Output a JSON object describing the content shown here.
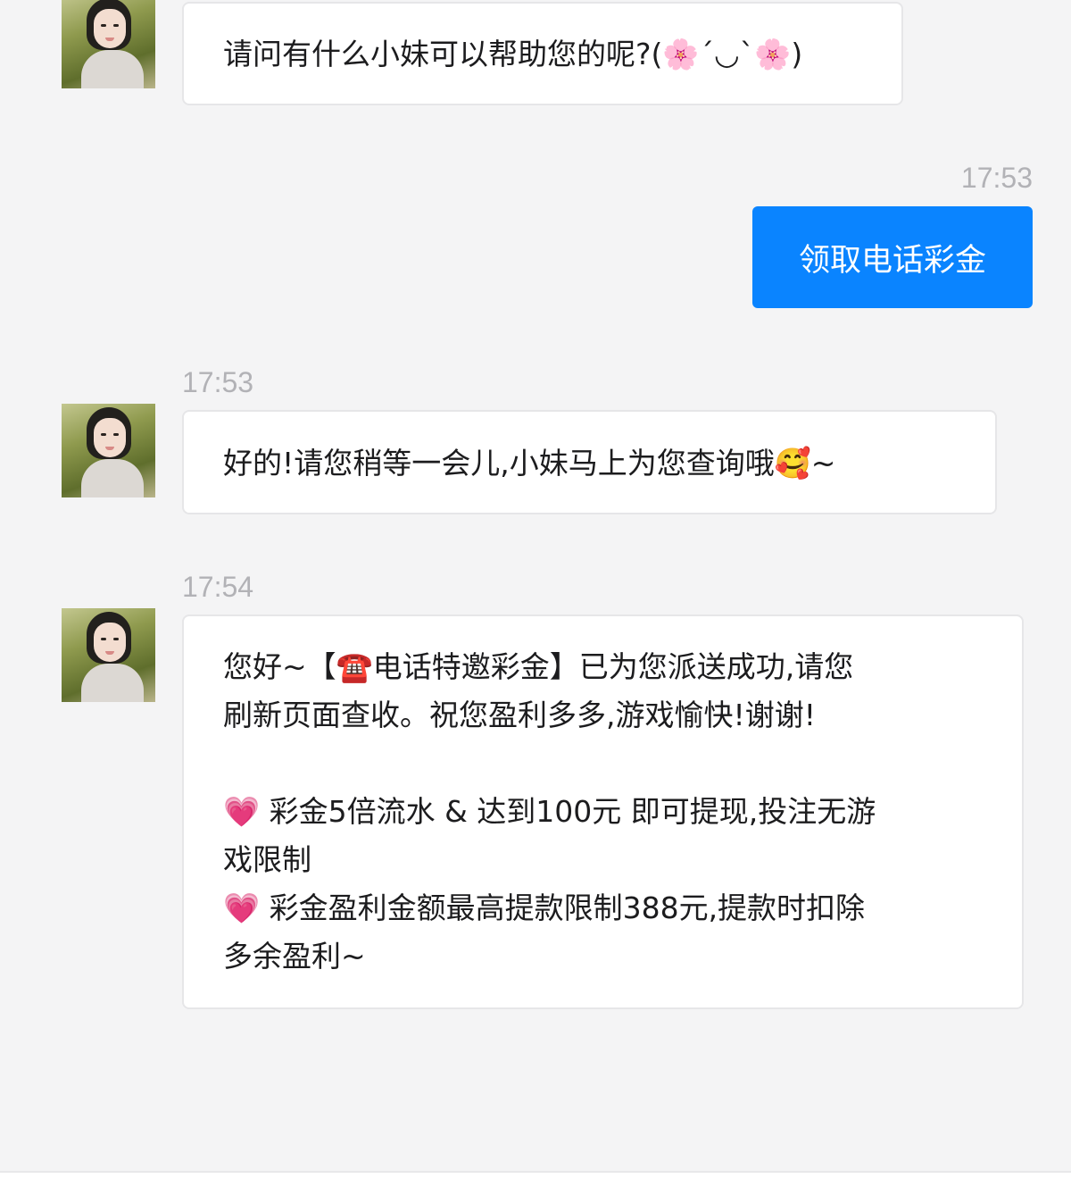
{
  "messages": [
    {
      "sender": "agent",
      "text": "请问有什么小妹可以帮助您的呢?(🌸´◡`🌸)"
    },
    {
      "sender": "user",
      "time": "17:53",
      "text": "领取电话彩金"
    },
    {
      "sender": "agent",
      "time": "17:53",
      "text": "好的!请您稍等一会儿,小妹马上为您查询哦🥰~"
    },
    {
      "sender": "agent",
      "time": "17:54",
      "text": "您好~【☎️电话特邀彩金】已为您派送成功,请您\n刷新页面查收。祝您盈利多多,游戏愉快!谢谢!\n\n💗 彩金5倍流水 & 达到100元 即可提现,投注无游\n戏限制\n💗 彩金盈利金额最高提款限制388元,提款时扣除\n多余盈利~"
    }
  ],
  "icons": {
    "avatar": "agent-avatar"
  },
  "colors": {
    "background": "#f4f4f5",
    "user_bubble": "#0a84ff",
    "agent_bubble": "#ffffff",
    "timestamp": "#b2b2b6"
  }
}
